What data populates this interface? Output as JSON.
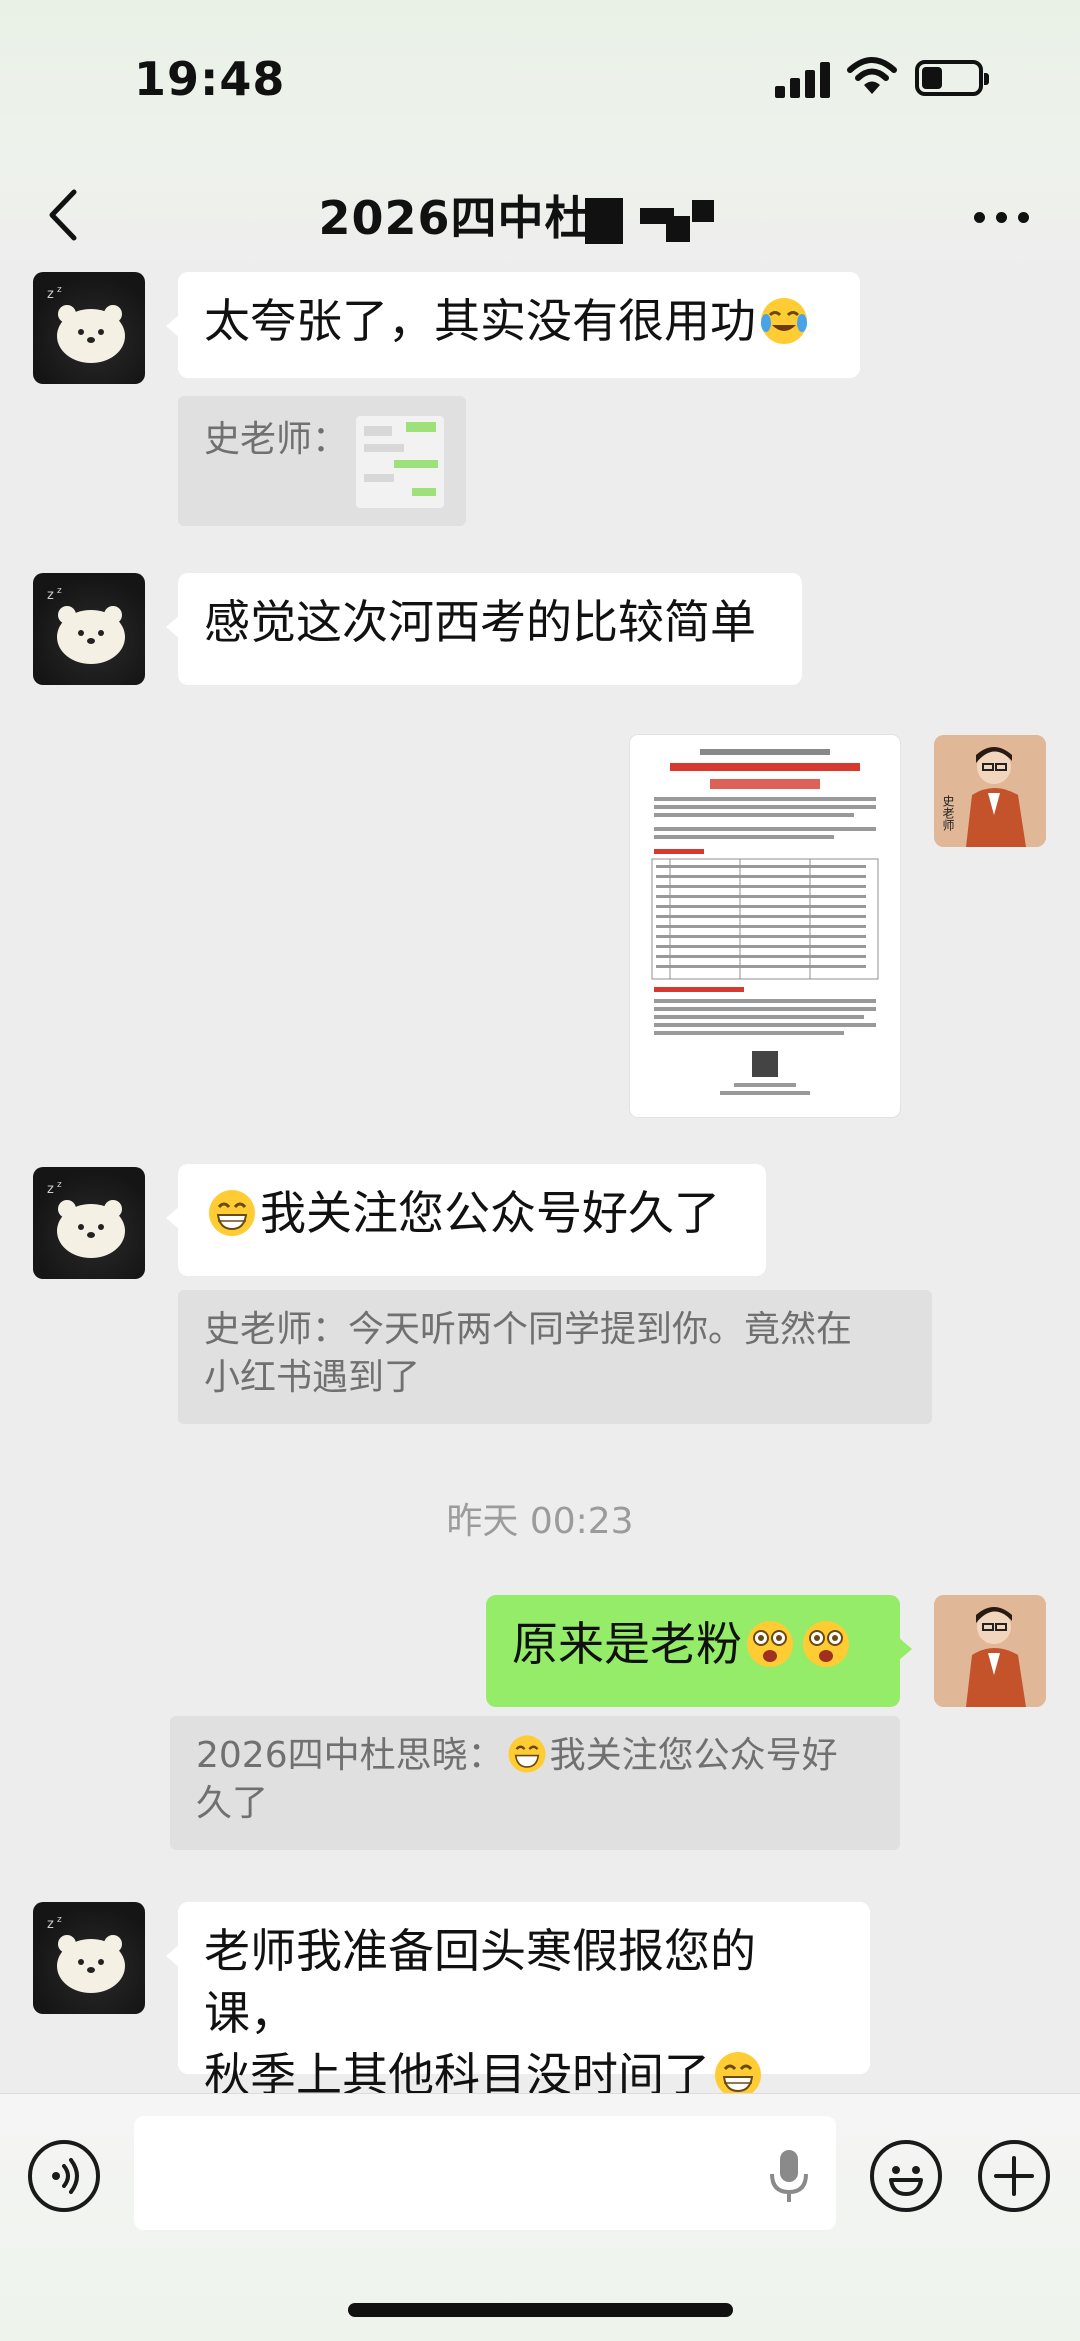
{
  "status_bar": {
    "time": "19:48"
  },
  "nav": {
    "title": "2026四中杜"
  },
  "messages": [
    {
      "sender": "other",
      "text": "太夸张了，其实没有很用功",
      "emoji": "cry-laugh-emoji"
    },
    {
      "sender": "other",
      "quote_label": "史老师：",
      "quote_type": "image"
    },
    {
      "sender": "other",
      "text": "感觉这次河西考的比较简单"
    },
    {
      "sender": "me",
      "type": "image",
      "image": "document-image"
    },
    {
      "sender": "other",
      "text": "我关注您公众号好久了",
      "emoji": "grin-emoji",
      "quote": "史老师：今天听两个同学提到你。竟然在小红书遇到了"
    },
    {
      "sender": "me",
      "text": "原来是老粉",
      "emoji": "wow-emoji",
      "quote": "2026四中杜思晓：😁我关注您公众号好久了"
    },
    {
      "sender": "other",
      "text_line1": "老师我准备回头寒假报您的课，",
      "text_line2": "秋季上其他科目没时间了",
      "emoji": "grin-emoji"
    }
  ],
  "timestamp": "昨天 00:23",
  "quote_lines": {
    "q2_line1": "史老师：今天听两个同学提到你。竟然在",
    "q2_line2": "小红书遇到了",
    "q3_prefix": "2026四中杜思晓：",
    "q3_line1_rest": "我关注您公众号好",
    "q3_line2": "久了"
  },
  "avatar_teacher_label": "史老师",
  "input": {
    "placeholder": ""
  },
  "colors": {
    "bubble_mine": "#95ec69",
    "bubble_other": "#ffffff",
    "background": "#ededed"
  }
}
